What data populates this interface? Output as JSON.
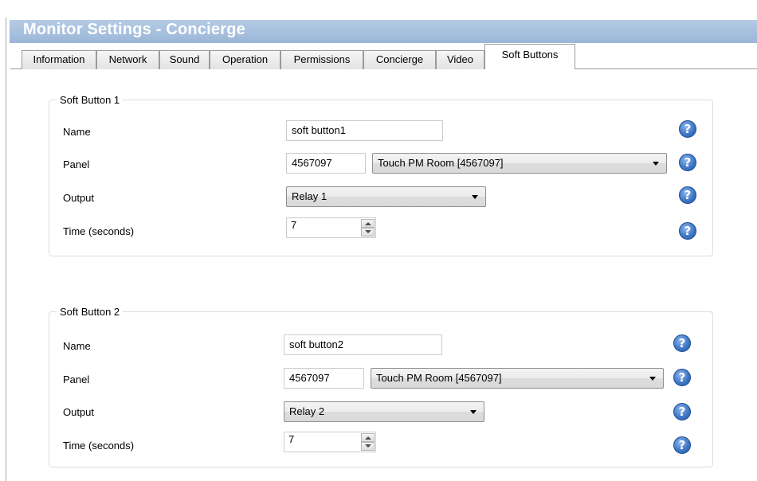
{
  "window": {
    "title": "Monitor Settings - Concierge"
  },
  "tabs": [
    {
      "label": "Information"
    },
    {
      "label": "Network"
    },
    {
      "label": "Sound"
    },
    {
      "label": "Operation"
    },
    {
      "label": "Permissions"
    },
    {
      "label": "Concierge"
    },
    {
      "label": "Video"
    },
    {
      "label": "Soft Buttons",
      "active": true
    }
  ],
  "groups": [
    {
      "title": "Soft Button 1",
      "name_label": "Name",
      "name_value": "soft button1",
      "panel_label": "Panel",
      "panel_id": "4567097",
      "panel_select": "Touch PM Room [4567097]",
      "output_label": "Output",
      "output_select": "Relay 1",
      "time_label": "Time (seconds)",
      "time_value": "7"
    },
    {
      "title": "Soft Button 2",
      "name_label": "Name",
      "name_value": "soft button2",
      "panel_label": "Panel",
      "panel_id": "4567097",
      "panel_select": "Touch PM Room [4567097]",
      "output_label": "Output",
      "output_select": "Relay 2",
      "time_label": "Time (seconds)",
      "time_value": "7"
    }
  ],
  "help_icon_glyph": "?",
  "colors": {
    "titlebar": "#a9c2e1",
    "help_icon": "#3f78c9"
  }
}
